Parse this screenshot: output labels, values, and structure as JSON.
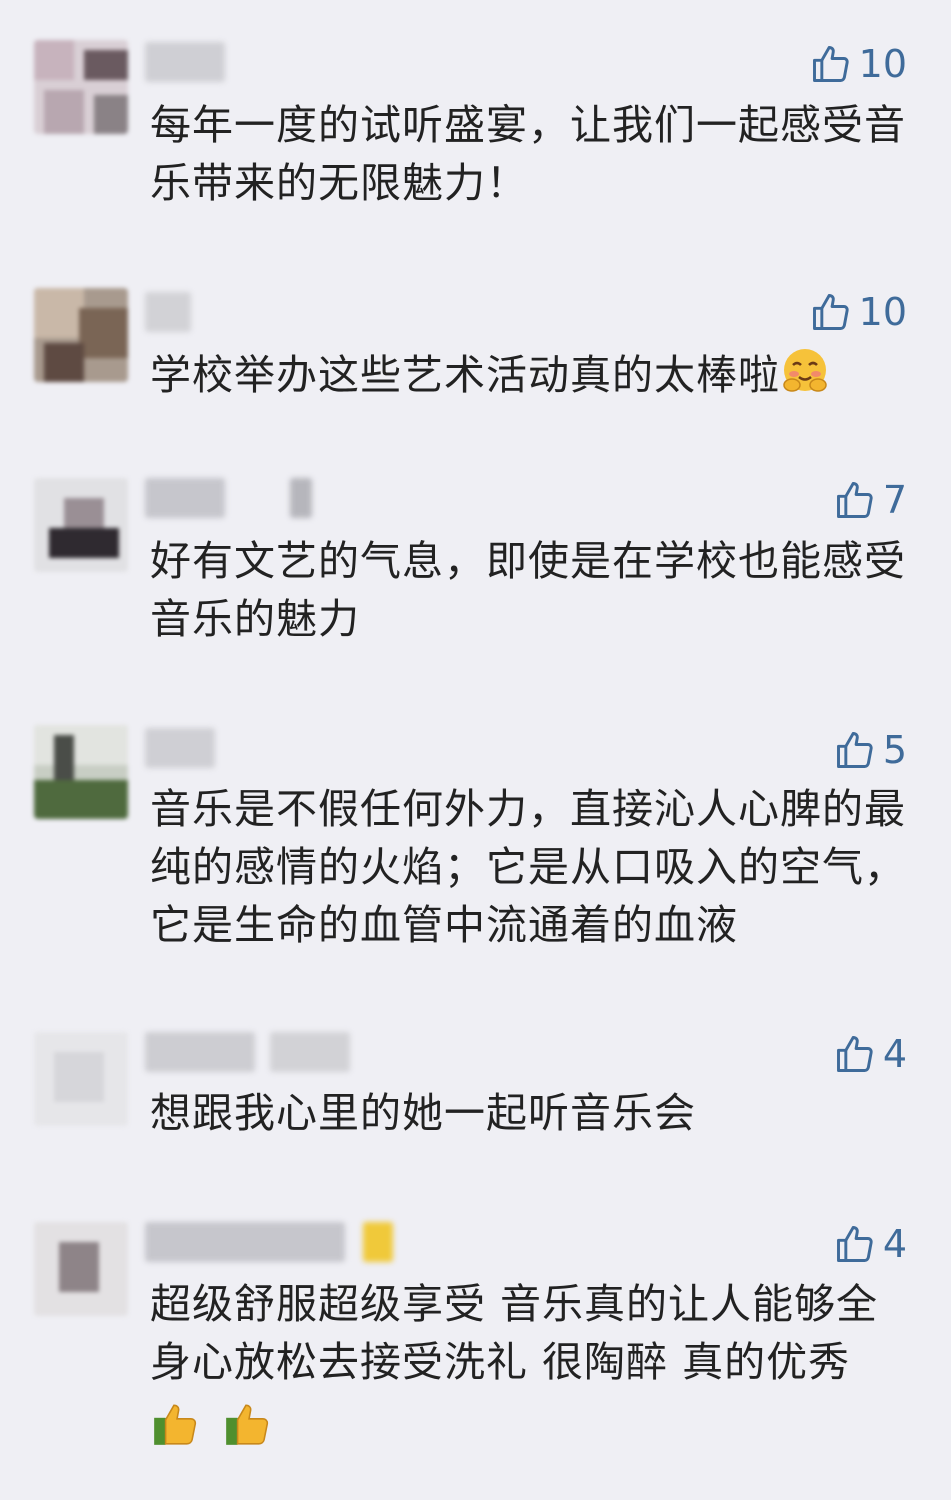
{
  "comments": [
    {
      "likes": "10",
      "text": "每年一度的试听盛宴，让我们一起感受音乐带来的无限魅力！"
    },
    {
      "likes": "10",
      "text": "学校举办这些艺术活动真的太棒啦",
      "emoji": "blush-hug-emoji"
    },
    {
      "likes": "7",
      "text": "好有文艺的气息，即使是在学校也能感受音乐的魅力"
    },
    {
      "likes": "5",
      "text": "音乐是不假任何外力，直接沁人心脾的最纯的感情的火焰；它是从口吸入的空气，它是生命的血管中流通着的血液"
    },
    {
      "likes": "4",
      "text": "想跟我心里的她一起听音乐会"
    },
    {
      "likes": "4",
      "text": "超级舒服超级享受 音乐真的让人能够全身心放松去接受洗礼 很陶醉 真的优秀",
      "emoji": "thumbs-up-emoji"
    }
  ],
  "colors": {
    "background": "#efeff4",
    "like": "#3f6b9a",
    "text": "#222222"
  }
}
